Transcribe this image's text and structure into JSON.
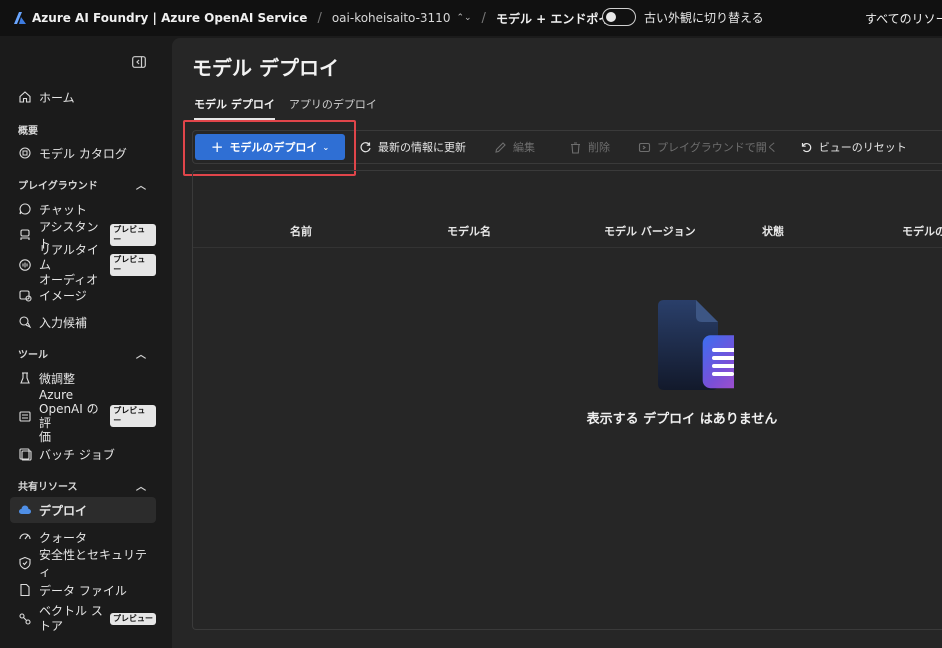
{
  "topbar": {
    "brand": "Azure AI Foundry | Azure OpenAI Service",
    "resource": "oai-koheisaito-3110",
    "page": "モデル + エンドポイント",
    "toggle_label": "古い外観に切り替える",
    "all_resources": "すべてのリソー"
  },
  "sidebar": {
    "home": "ホーム",
    "overview_head": "概要",
    "model_catalog": "モデル カタログ",
    "playground_head": "プレイグラウンド",
    "chat": "チャット",
    "assistant": "アシスタント",
    "realtime_1": "リアルタイム",
    "realtime_2": "オーディオ",
    "image": "イメージ",
    "completion": "入力候補",
    "tools_head": "ツール",
    "finetune": "微調整",
    "eval_1": "Azure",
    "eval_2": "OpenAI の評",
    "eval_3": "価",
    "batch": "バッチ ジョブ",
    "shared_head": "共有リソース",
    "deploy": "デプロイ",
    "quota": "クォータ",
    "safety": "安全性とセキュリティ",
    "datafile": "データ ファイル",
    "vector_1": "ベクトル ス",
    "vector_2": "トア",
    "preview_badge": "プレビュー"
  },
  "main": {
    "title": "モデル デプロイ",
    "tabs": [
      "モデル デプロイ",
      "アプリのデプロイ"
    ],
    "toolbar": {
      "deploy": "モデルのデプロイ",
      "refresh": "最新の情報に更新",
      "edit": "編集",
      "delete": "削除",
      "open_playground": "プレイグラウンドで開く",
      "reset_view": "ビューのリセット"
    },
    "columns": [
      "名前",
      "モデル名",
      "モデル バージョン",
      "状態",
      "モデルの"
    ],
    "empty_message": "表示する デプロイ はありません"
  },
  "colors": {
    "accent": "#2f6fd4",
    "highlight": "#e0454a",
    "active_bar": "#4f8fe6"
  },
  "icons": {
    "brand": "azure-foundry-logo-icon",
    "empty": "empty-documents-icon"
  }
}
